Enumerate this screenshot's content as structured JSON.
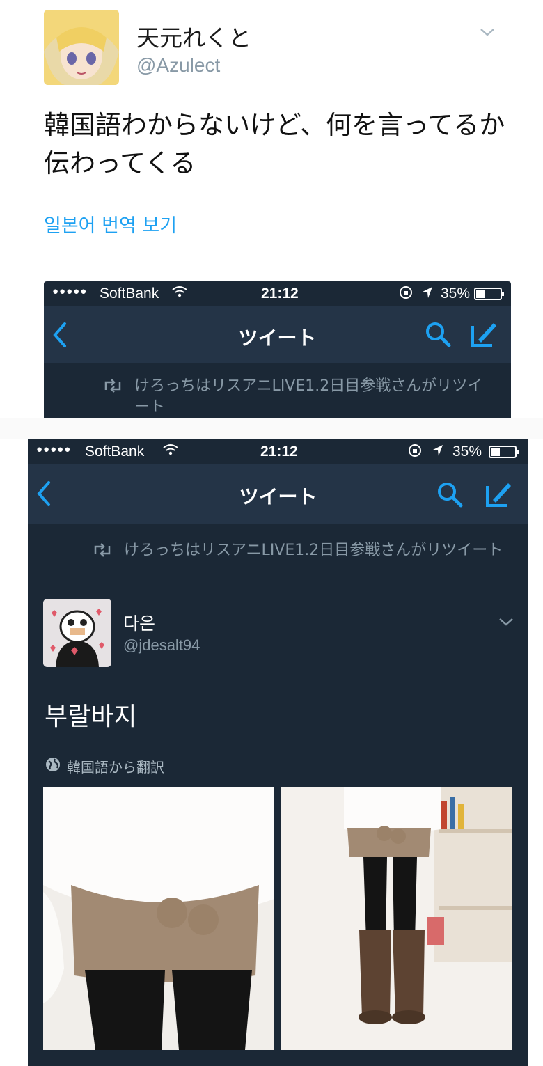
{
  "tweet": {
    "display_name": "天元れくと",
    "handle": "@Azulect",
    "text": "韓国語わからないけど、何を言ってるか伝わってくる",
    "translate_link": "일본어 번역 보기"
  },
  "screenshot1": {
    "status": {
      "dots": "●●●●●",
      "carrier": "SoftBank",
      "time": "21:12",
      "battery": "35%"
    },
    "nav_title": "ツイート",
    "retweet_text": "けろっちはリスアニLIVE1.2日目参戦さんがリツイート"
  },
  "screenshot2": {
    "status": {
      "dots": "●●●●●",
      "carrier": "SoftBank",
      "time": "21:12",
      "battery": "35%"
    },
    "nav_title": "ツイート",
    "retweet_text": "けろっちはリスアニLIVE1.2日目参戦さんがリツイート",
    "author_name": "다은",
    "author_handle": "@jdesalt94",
    "tweet_text": "부랄바지",
    "translation_label": "韓国語から翻訳"
  },
  "colors": {
    "accent": "#1da1f2",
    "dark_bg": "#1b2836",
    "nav_bg": "#243447",
    "muted": "#8899a6"
  },
  "icons": [
    "chevron-down-icon",
    "wifi-icon",
    "lock-rotation-icon",
    "location-arrow-icon",
    "battery-icon",
    "back-chevron-icon",
    "search-icon",
    "compose-icon",
    "retweet-icon",
    "globe-icon"
  ]
}
